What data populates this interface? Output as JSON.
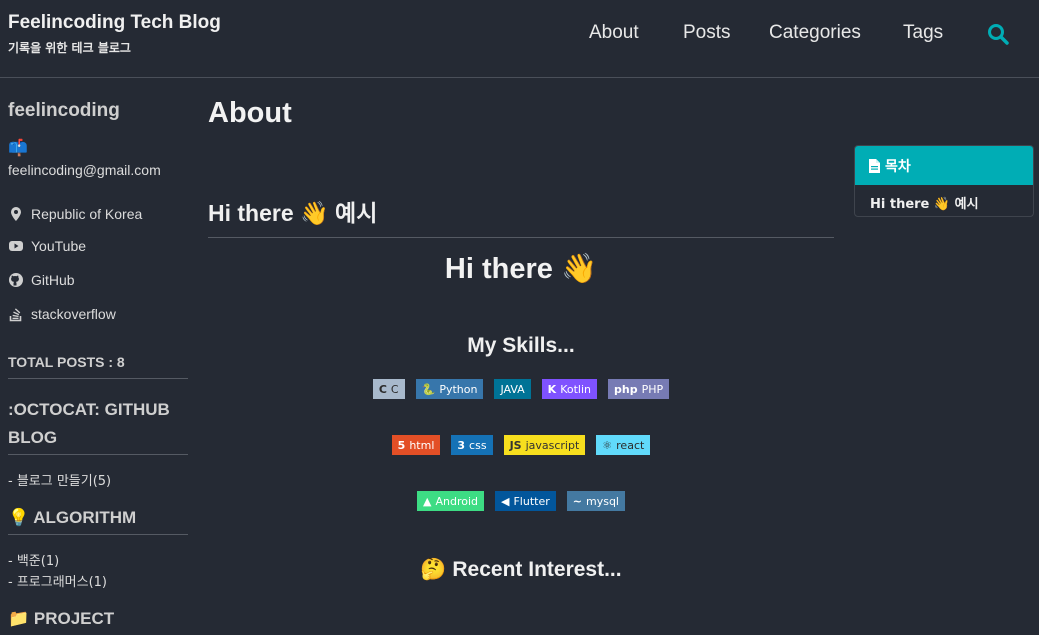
{
  "site": {
    "title": "Feelincoding Tech Blog",
    "subtitle": "기록을 위한 테크 블로그"
  },
  "nav": {
    "items": [
      "About",
      "Posts",
      "Categories",
      "Tags"
    ],
    "search_icon": "search-icon"
  },
  "sidebar": {
    "author": "feelincoding",
    "mailbox_emoji": "📫",
    "email": "feelincoding@gmail.com",
    "links": [
      {
        "label": "Republic of Korea",
        "icon": "map-marker-icon"
      },
      {
        "label": "YouTube",
        "icon": "youtube-icon"
      },
      {
        "label": "GitHub",
        "icon": "github-icon"
      },
      {
        "label": "stackoverflow",
        "icon": "stackoverflow-icon"
      }
    ],
    "total_posts": "TOTAL POSTS : 8",
    "categories": [
      {
        "heading": ":OCTOCAT: GITHUB BLOG",
        "items": [
          "- 블로그 만들기(5)"
        ]
      },
      {
        "heading": "💡 ALGORITHM",
        "items": [
          "- 백준(1)",
          "- 프로그래머스(1)"
        ]
      },
      {
        "heading": "📁 PROJECT",
        "items": []
      }
    ]
  },
  "main": {
    "page_title": "About",
    "section_heading": "Hi there 👋 예시",
    "hero": "Hi there 👋",
    "skills_heading": "My Skills...",
    "badge_rows": [
      [
        {
          "label": "C",
          "glyph": "C",
          "color": "#a8b9cc",
          "text_color": "#2b2b2b"
        },
        {
          "label": "Python",
          "glyph": "🐍",
          "color": "#3776ab",
          "text_color": "#ffffff"
        },
        {
          "label": "JAVA",
          "glyph": "",
          "color": "#007396",
          "text_color": "#ffffff"
        },
        {
          "label": "Kotlin",
          "glyph": "K",
          "color": "#7f52ff",
          "text_color": "#ffffff"
        },
        {
          "label": "PHP",
          "glyph": "php",
          "color": "#777bb4",
          "text_color": "#ffffff"
        }
      ],
      [
        {
          "label": "html",
          "glyph": "5",
          "color": "#e34f26",
          "text_color": "#ffffff"
        },
        {
          "label": "css",
          "glyph": "3",
          "color": "#1572b6",
          "text_color": "#ffffff"
        },
        {
          "label": "javascript",
          "glyph": "JS",
          "color": "#f7df1e",
          "text_color": "#333333"
        },
        {
          "label": "react",
          "glyph": "⚛",
          "color": "#61dafb",
          "text_color": "#2b2b2b"
        }
      ],
      [
        {
          "label": "Android",
          "glyph": "▲",
          "color": "#3ddc84",
          "text_color": "#ffffff"
        },
        {
          "label": "Flutter",
          "glyph": "◀",
          "color": "#02569b",
          "text_color": "#ffffff"
        },
        {
          "label": "mysql",
          "glyph": "~",
          "color": "#4479a1",
          "text_color": "#ffffff"
        }
      ]
    ],
    "interest_heading": "🤔 Recent Interest..."
  },
  "toc": {
    "title": "목차",
    "items": [
      "Hi there 👋 예시"
    ]
  },
  "colors": {
    "background": "#252a34",
    "accent": "#00adb5"
  }
}
